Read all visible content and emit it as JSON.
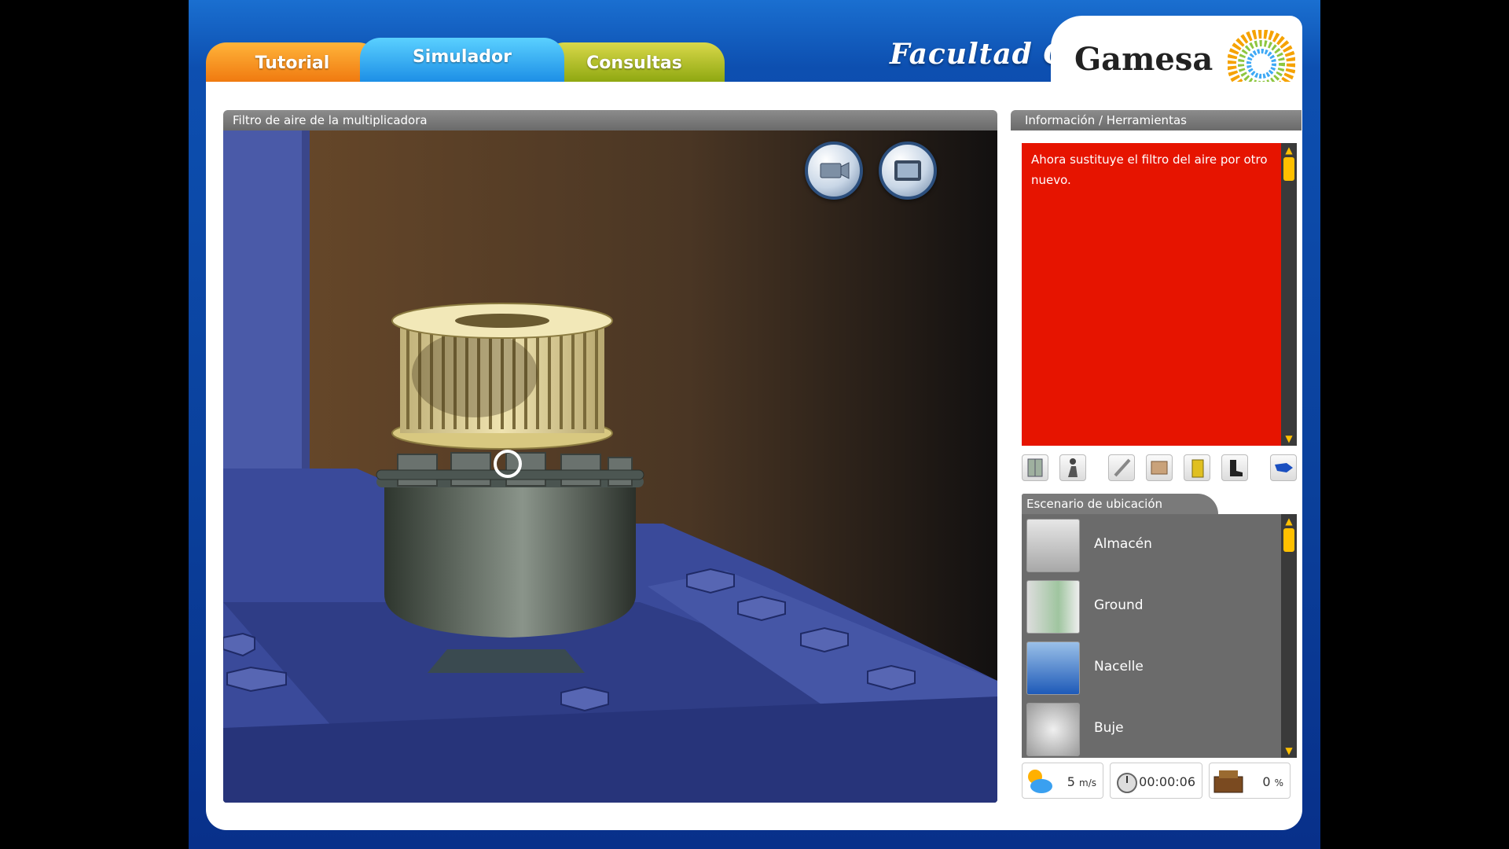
{
  "tabs": [
    {
      "label": "Tutorial"
    },
    {
      "label": "Simulador"
    },
    {
      "label": "Consultas"
    }
  ],
  "brand": {
    "faculty": "Facultad CCS",
    "company": "Gamesa"
  },
  "viewport": {
    "title": "Filtro de aire de la multiplicadora"
  },
  "side": {
    "title": "Información / Herramientas",
    "message": "Ahora sustituye el filtro del aire por otro nuevo.",
    "scenario_title": "Escenario de ubicación",
    "locations": [
      {
        "label": "Almacén"
      },
      {
        "label": "Ground"
      },
      {
        "label": "Nacelle"
      },
      {
        "label": "Buje"
      }
    ],
    "toolbar_icons": [
      "cabinet-icon",
      "worker-icon",
      "cutter-icon",
      "manual-icon",
      "battery-icon",
      "boot-icon",
      "blue-tool-icon"
    ]
  },
  "status": {
    "wind_value": "5",
    "wind_unit": "m/s",
    "time": "00:00:06",
    "progress": "0",
    "progress_unit": "%"
  },
  "colors": {
    "message_bg": "#e61400",
    "scroll_accent": "#ffc000",
    "tab_simulador": "#1d8fe6"
  }
}
